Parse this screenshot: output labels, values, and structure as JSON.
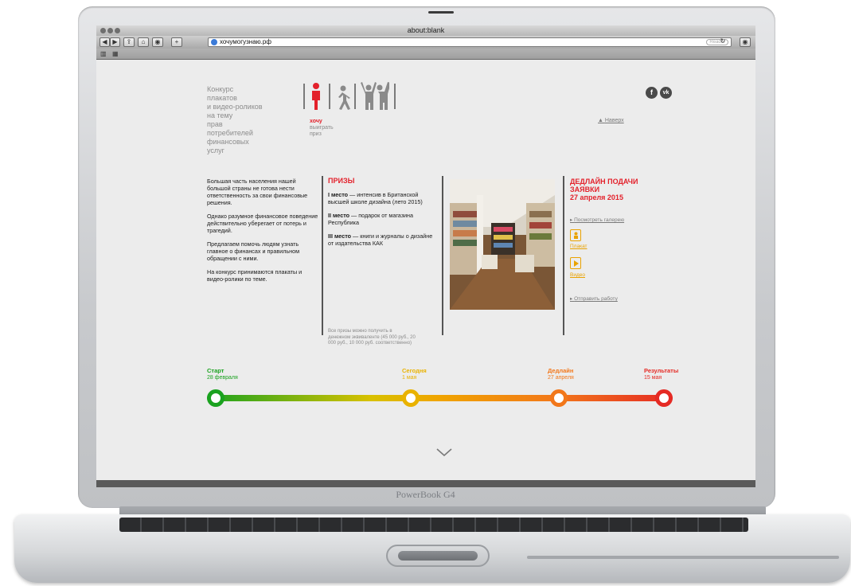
{
  "browser": {
    "window_title": "about:blank",
    "url": "хочумогузнаю.рф",
    "reader_label": "Reader",
    "nav_labels": {
      "back": "◀",
      "forward": "▶"
    }
  },
  "laptop": {
    "brand": "PowerBook G4"
  },
  "site": {
    "title_lines": [
      "Конкурс",
      "плакатов",
      "и видео-роликов",
      "на тему",
      "прав",
      "потребителей",
      "финансовых",
      "услуг"
    ],
    "pictograms": [
      "хочу",
      "выиграть",
      "приз"
    ],
    "back_link": "Наверх",
    "social": [
      "facebook-icon",
      "vk-icon"
    ]
  },
  "intro": {
    "paragraphs": [
      "Большая часть населения нашей большой страны не готова нести ответственность за свои финансовые решения.",
      "Однако разумное финансовое поведение действительно уберегает от потерь и трагедий.",
      "Предлагаем помочь людям узнать главное о финансах и правильном обращении с ними.",
      "На конкурс принимаются плакаты и видео-ролики по теме."
    ]
  },
  "prizes": {
    "heading": "ПРИЗЫ",
    "items": [
      {
        "place": "I место",
        "text": " — интенсив в Британской высшей школе дизайна (лето 2015)"
      },
      {
        "place": "II место",
        "text": " — подарок от магазина Республика"
      },
      {
        "place": "III место",
        "text": " — книги и журналы о дизайне от издательства КАК"
      }
    ],
    "note": "Все призы можно получить в денежном эквиваленте (45 000 руб., 20 000 руб., 10 000 руб. соответственно)"
  },
  "deadline": {
    "heading_line1": "ДЕДЛАЙН ПОДАЧИ",
    "heading_line2": "ЗАЯВКИ",
    "date": "27 апреля 2015",
    "gallery_link": "Посмотреть галерею",
    "poster_label": "Плакат",
    "video_label": "Видео",
    "submit_link": "Отправить работу"
  },
  "timeline": {
    "stages": [
      {
        "label": "Старт",
        "date": "28 февраля",
        "color": "#1aa21f"
      },
      {
        "label": "Сегодня",
        "date": "1 мая",
        "color": "#e9b200"
      },
      {
        "label": "Дедлайн",
        "date": "27 апреля",
        "color": "#f2771a"
      },
      {
        "label": "Результаты",
        "date": "15 мая",
        "color": "#e52a24"
      }
    ]
  },
  "colors": {
    "accent": "#e3212b",
    "page_bg": "#ececec",
    "orange": "#e9a200"
  }
}
